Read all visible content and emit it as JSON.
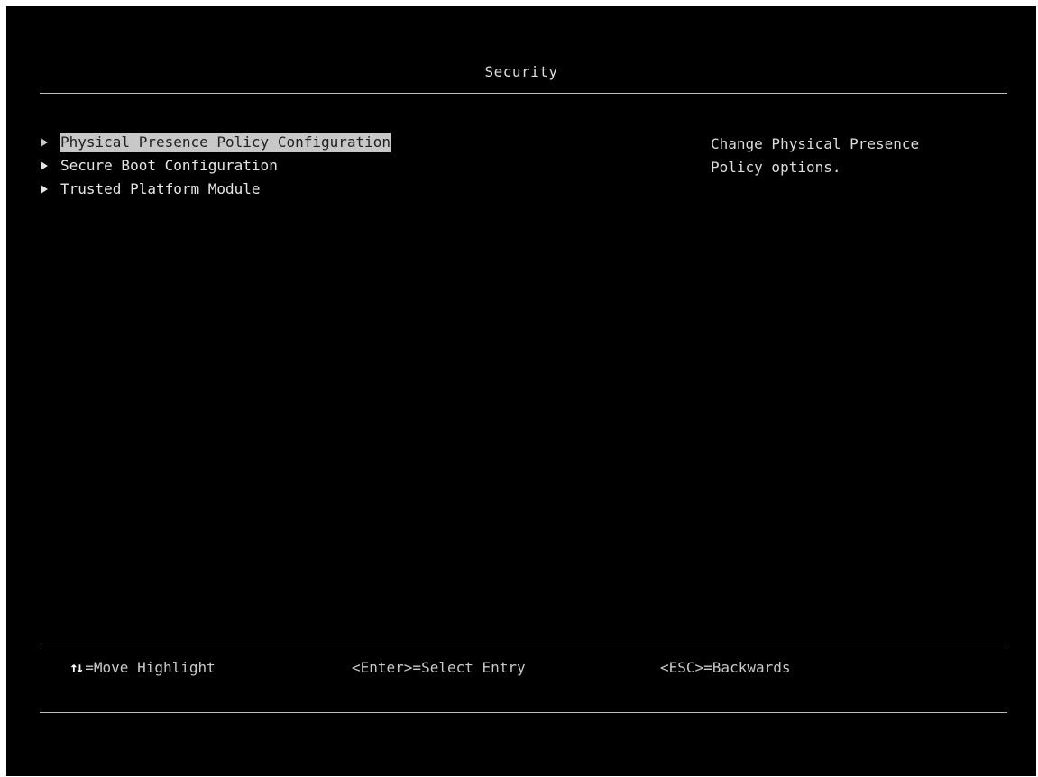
{
  "header": {
    "title": "Security"
  },
  "menu": {
    "items": [
      {
        "label": "Physical Presence Policy Configuration",
        "selected": true
      },
      {
        "label": "Secure Boot Configuration",
        "selected": false
      },
      {
        "label": "Trusted Platform Module",
        "selected": false
      }
    ]
  },
  "help": {
    "lines": [
      "Change Physical Presence",
      "Policy options."
    ]
  },
  "footer": {
    "move_icon": "↑↓",
    "move_label": "=Move Highlight",
    "select_label": "<Enter>=Select Entry",
    "back_label": "<ESC>=Backwards"
  },
  "colors": {
    "background": "#000000",
    "text": "#e6e6e6",
    "highlight_bg": "#c8c8c8",
    "highlight_fg": "#202020"
  },
  "icons": {
    "menu_arrow": "triangle-right-icon",
    "navigation": "up-down-arrows-icon"
  }
}
